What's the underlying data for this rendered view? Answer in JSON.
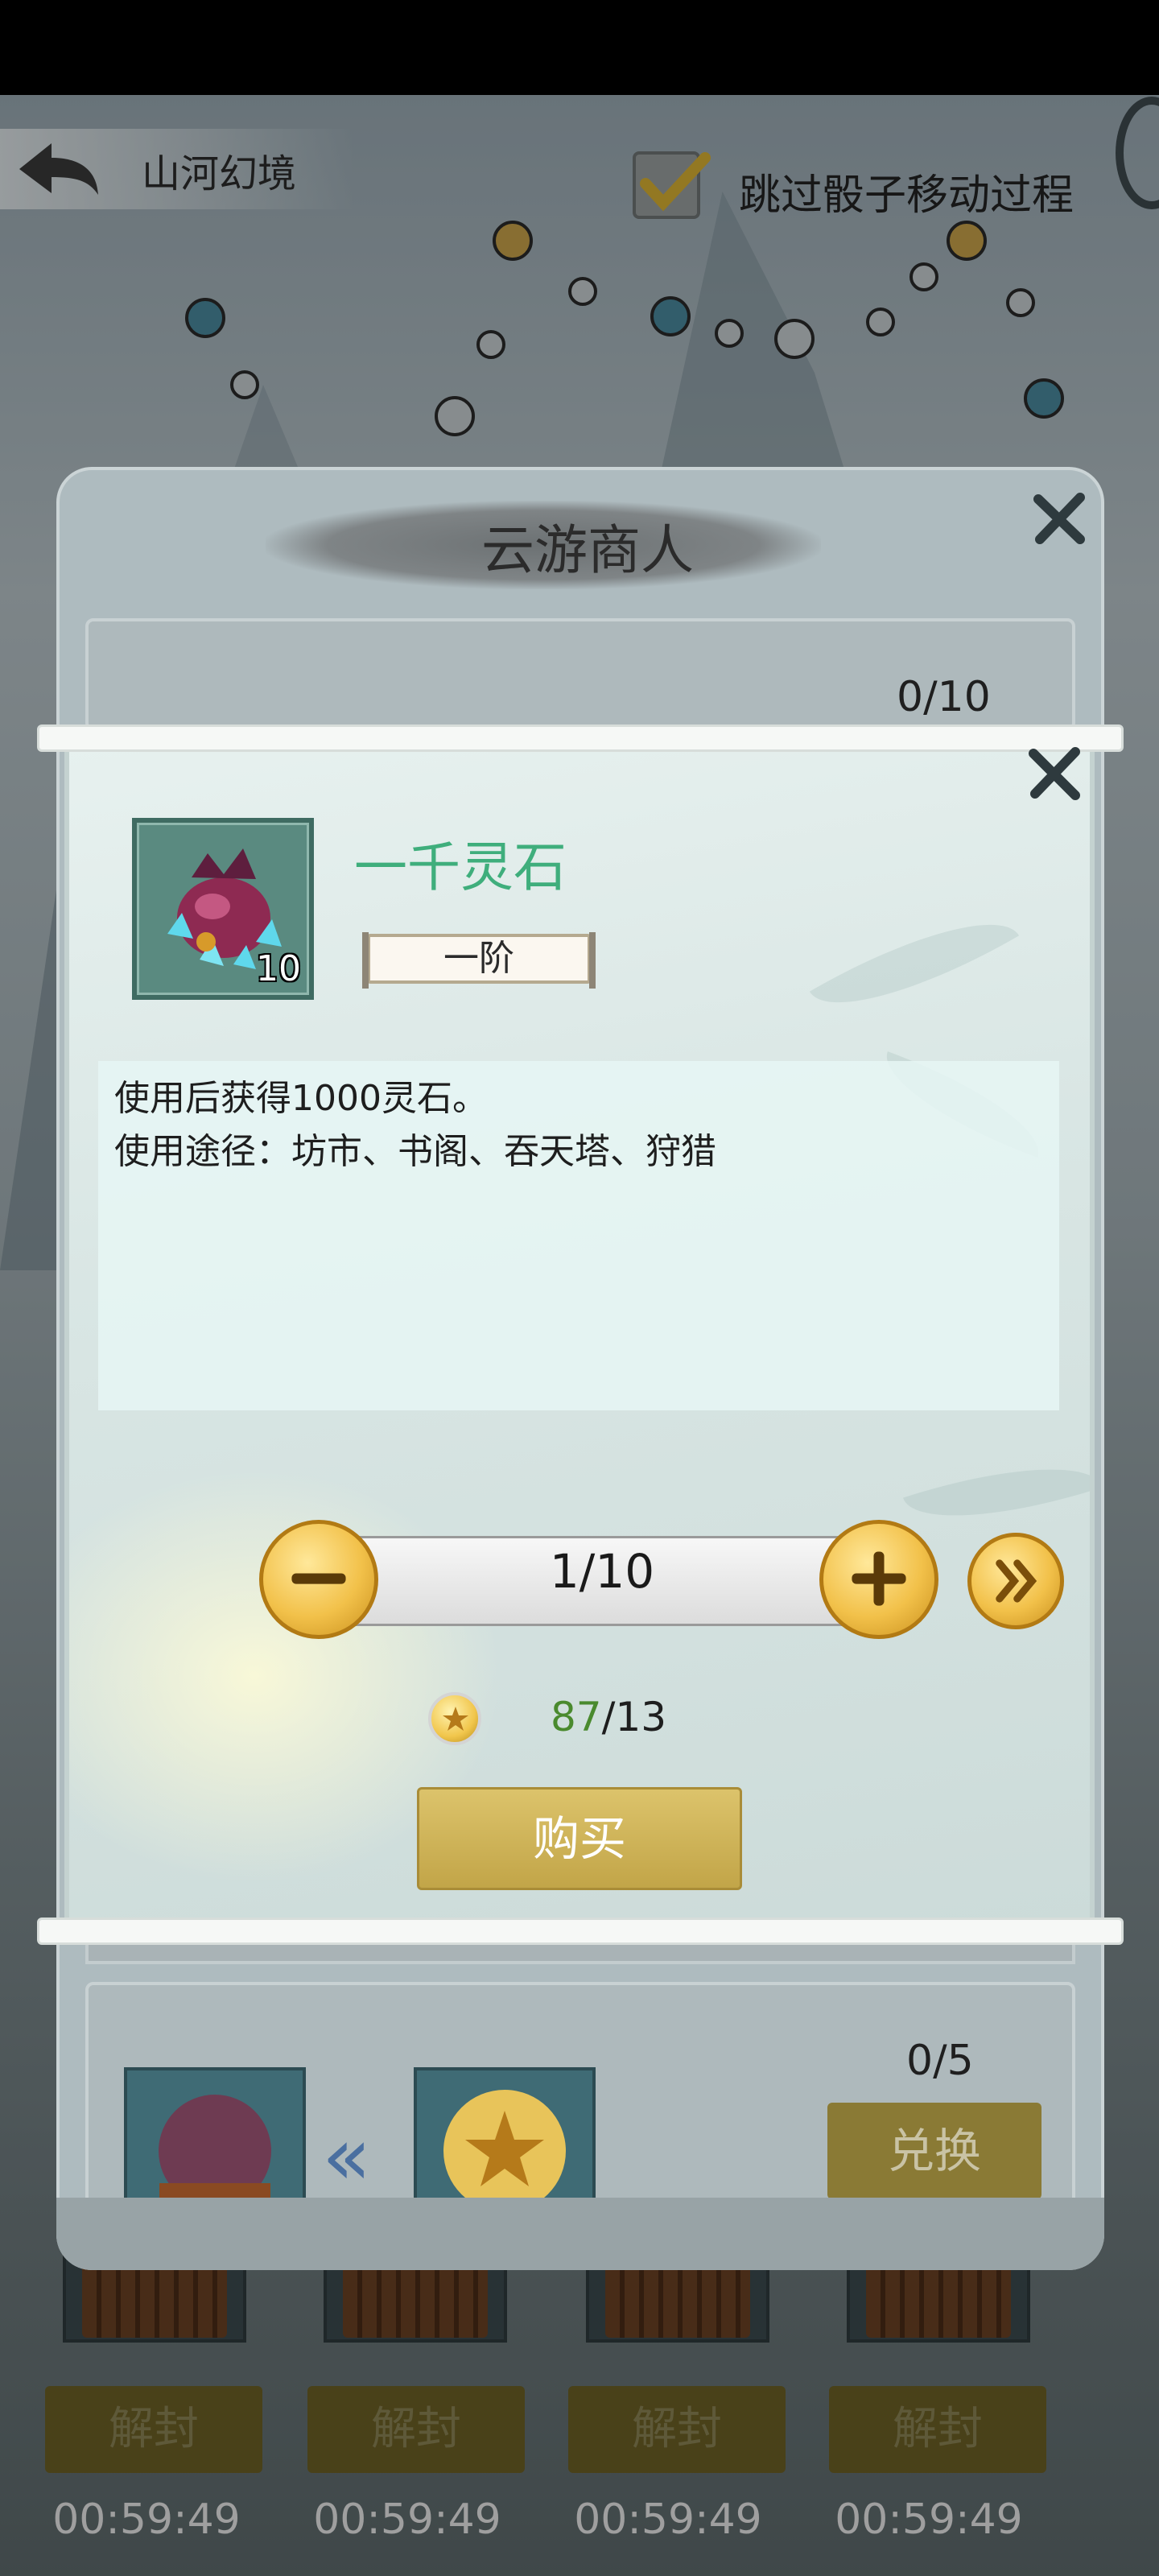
{
  "header": {
    "title": "山河幻境",
    "skip_label": "跳过骰子移动过程",
    "skip_checked": true
  },
  "merchant": {
    "title": "云游商人",
    "slot1_count": "0/10",
    "slot2_count": "0/5",
    "exchange_label": "兑换"
  },
  "popup": {
    "item_name": "一千灵石",
    "item_count": "10",
    "tier": "一阶",
    "description": [
      "使用后获得1000灵石。",
      "使用途径：坊市、书阁、吞天塔、狩猎"
    ],
    "quantity": "1/10",
    "cost_have": "87",
    "cost_need": "/13",
    "buy_label": "购买",
    "colors": {
      "item_name": "#3fae7c",
      "cost_have": "#4a8a2e",
      "button_gold": "#c2a548"
    }
  },
  "chests": {
    "unseal_label": "解封",
    "timers": [
      "00:59:49",
      "00:59:49",
      "00:59:49",
      "00:59:49"
    ]
  },
  "icons": [
    "back-arrow-icon",
    "checkmark-icon",
    "close-icon",
    "minus-icon",
    "plus-icon",
    "double-chevron-right-icon",
    "star-coin-icon",
    "double-chevron-left-icon"
  ]
}
